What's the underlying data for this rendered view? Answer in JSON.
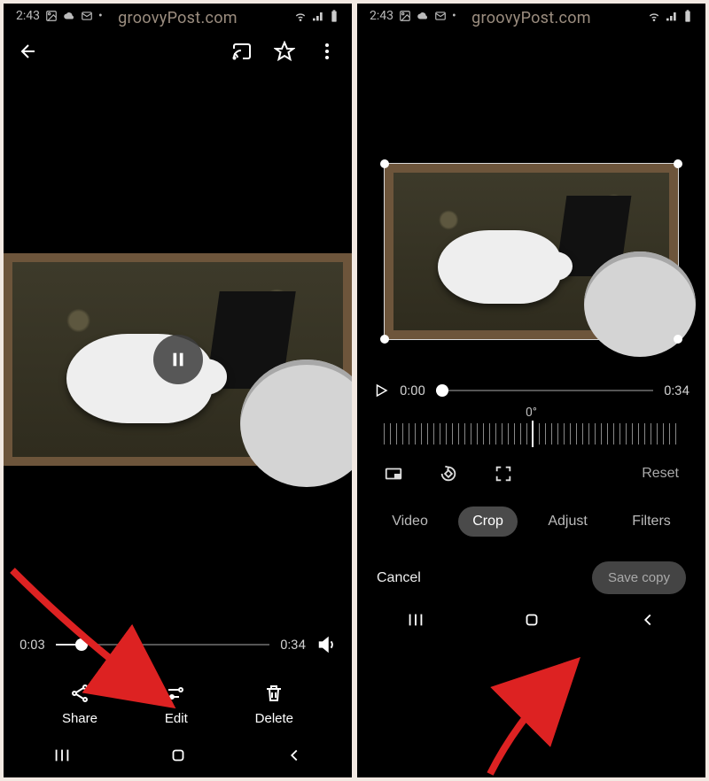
{
  "status": {
    "time": "2:43",
    "extras": "•"
  },
  "watermark": "groovyPost.com",
  "left": {
    "scrub": {
      "current": "0:03",
      "duration": "0:34",
      "progress_pct": 12
    },
    "actions": {
      "share": "Share",
      "edit": "Edit",
      "delete": "Delete"
    }
  },
  "right": {
    "scrub": {
      "current": "0:00",
      "duration": "0:34",
      "progress_pct": 3
    },
    "rotation_label": "0°",
    "reset": "Reset",
    "tabs": {
      "video": "Video",
      "crop": "Crop",
      "adjust": "Adjust",
      "filters": "Filters"
    },
    "cancel": "Cancel",
    "save_copy": "Save copy"
  }
}
